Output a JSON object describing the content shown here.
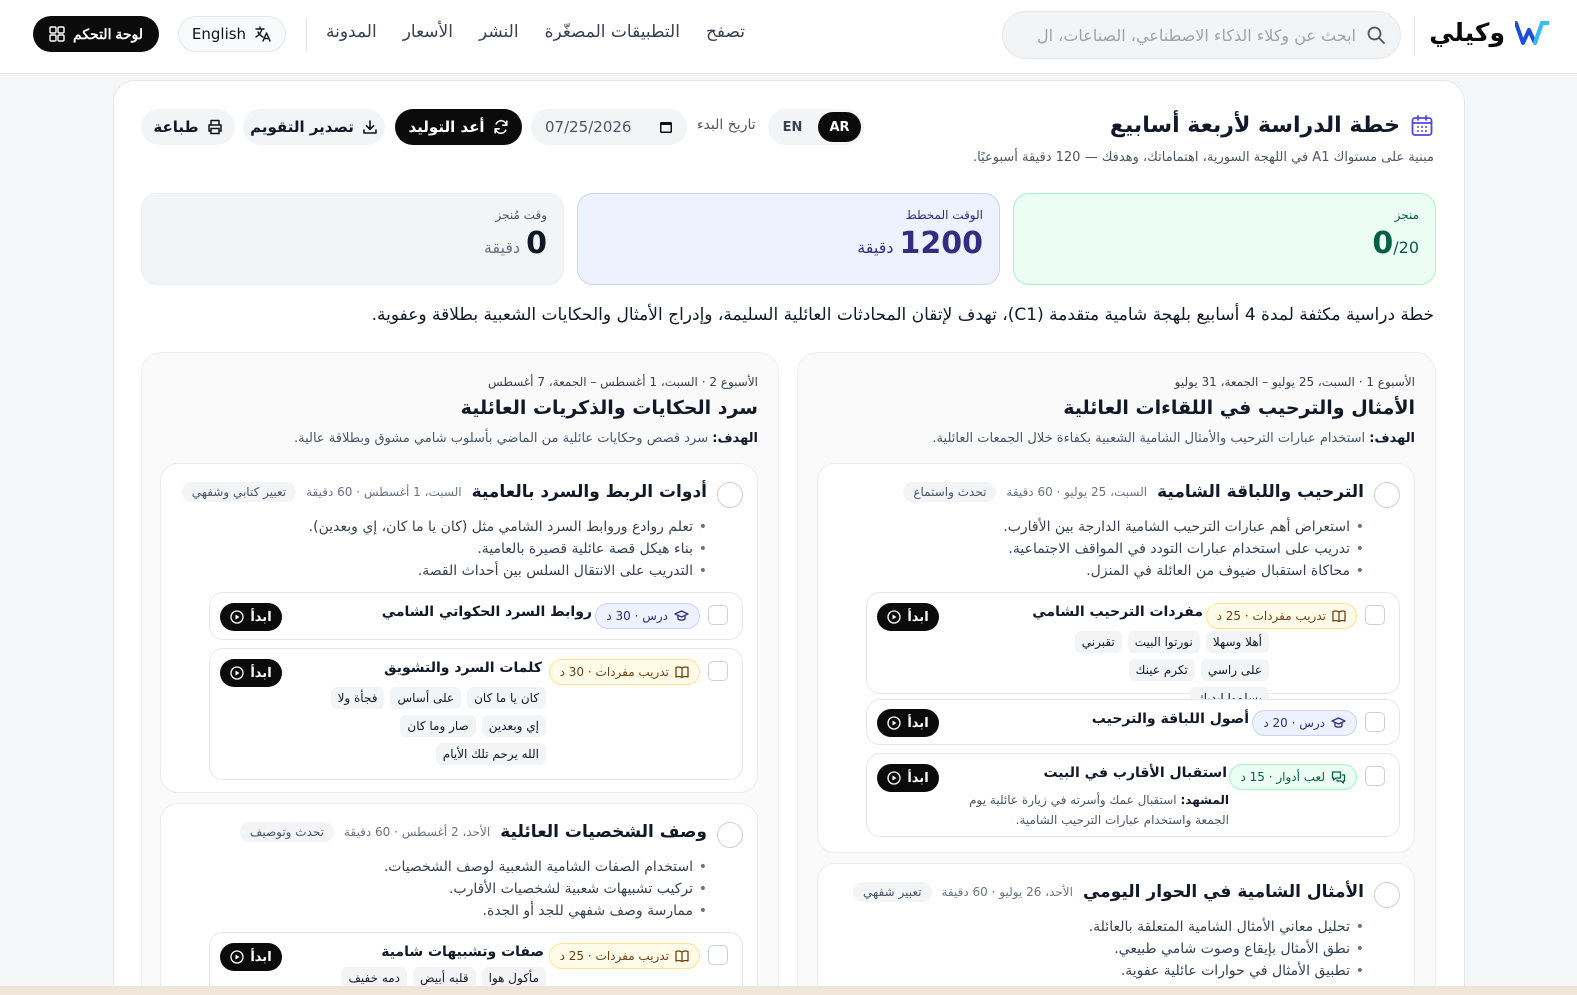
{
  "brand": {
    "name": "وكيلي"
  },
  "search": {
    "placeholder": "ابحث عن وكلاء الذكاء الاصطناعي، الصناعات، ال"
  },
  "nav": {
    "items": [
      "تصفح",
      "التطبيقات المصغّرة",
      "النشر",
      "الأسعار",
      "المدونة"
    ]
  },
  "lang_button": "English",
  "dashboard_button": "لوحة التحكم",
  "plan": {
    "title": "خطة الدراسة لأربعة أسابيع",
    "subtitle": "مبنية على مستواك A1 في اللهجة السورية، اهتماماتك، وهدفك — 120 دقيقة أسبوعيًا.",
    "lang_en": "EN",
    "lang_ar": "AR",
    "start_label": "تاريخ البدء",
    "start_date": "07/25/2026",
    "regenerate": "أعد التوليد",
    "export": "تصدير التقويم",
    "print": "طباعة",
    "description": "خطة دراسية مكثفة لمدة 4 أسابيع بلهجة شامية متقدمة (C1)، تهدف لإتقان المحادثات العائلية السليمة، وإدراج الأمثال والحكايات الشعبية بطلاقة وعفوية."
  },
  "stats": {
    "completed": {
      "label": "منجز",
      "value": "0",
      "total": "/20"
    },
    "planned": {
      "label": "الوقت المخطط",
      "value": "1200",
      "unit": "دقيقة"
    },
    "spent": {
      "label": "وقت مُنجز",
      "value": "0",
      "unit": "دقيقة"
    }
  },
  "goal_label": "الهدف:",
  "start_label": "ابدأ",
  "weeks": [
    {
      "meta": "الأسبوع 1 · السبت، 25 يوليو – الجمعة، 31 يوليو",
      "title": "الأمثال والترحيب في اللقاءات العائلية",
      "goal": "استخدام عبارات الترحيب والأمثال الشامية الشعبية بكفاءة خلال الجمعات العائلية.",
      "days": [
        {
          "title": "الترحيب واللباقة الشامية",
          "meta": "السبت، 25 يوليو · 60 دقيقة",
          "skill": "تحدث واستماع",
          "bullets": [
            "استعراض أهم عبارات الترحيب الشامية الدارجة بين الأقارب.",
            "تدريب على استخدام عبارات التودد في المواقف الاجتماعية.",
            "محاكاة استقبال ضيوف من العائلة في المنزل."
          ],
          "activities": [
            {
              "tag": "تدريب مفردات · 25 د",
              "title": "مفردات الترحيب الشامي",
              "words": [
                "أهلا وسهلا",
                "نورتوا البيت",
                "تقبرني",
                "على راسي",
                "تكرم عينك",
                "يسلموا إيديك"
              ]
            },
            {
              "tag": "درس · 20 د",
              "title": "أصول اللباقة والترحيب"
            },
            {
              "tag": "لعب أدوار · 15 د",
              "title": "استقبال الأقارب في البيت",
              "scene_label": "المشهد:",
              "scene": "استقبال عمك وأسرته في زيارة عائلية يوم الجمعة واستخدام عبارات الترحيب الشامية."
            }
          ]
        },
        {
          "title": "الأمثال الشامية في الحوار اليومي",
          "meta": "الأحد، 26 يوليو · 60 دقيقة",
          "skill": "تعبير شفهي",
          "bullets": [
            "تحليل معاني الأمثال الشامية المتعلقة بالعائلة.",
            "نطق الأمثال بإيقاع وصوت شامي طبيعي.",
            "تطبيق الأمثال في حوارات عائلية عفوية."
          ]
        }
      ]
    },
    {
      "meta": "الأسبوع 2 · السبت، 1 أغسطس – الجمعة، 7 أغسطس",
      "title": "سرد الحكايات والذكريات العائلية",
      "goal": "سرد قصص وحكايات عائلية من الماضي بأسلوب شامي مشوق وبطلاقة عالية.",
      "days": [
        {
          "title": "أدوات الربط والسرد بالعامية",
          "meta": "السبت، 1 أغسطس · 60 دقيقة",
          "skill": "تعبير كتابي وشفهي",
          "bullets": [
            "تعلم روادع وروابط السرد الشامي مثل (كان يا ما كان، إي وبعدين).",
            "بناء هيكل قصة عائلية قصيرة بالعامية.",
            "التدريب على الانتقال السلس بين أحداث القصة."
          ],
          "activities": [
            {
              "tag": "درس · 30 د",
              "title": "روابط السرد الحكواتي الشامي"
            },
            {
              "tag": "تدريب مفردات · 30 د",
              "title": "كلمات السرد والتشويق",
              "words": [
                "كان يا ما كان",
                "على أساس",
                "فجأة ولا",
                "إي وبعدين",
                "صار وما كان",
                "الله يرحم تلك الأيام"
              ]
            }
          ]
        },
        {
          "title": "وصف الشخصيات العائلية",
          "meta": "الأحد، 2 أغسطس · 60 دقيقة",
          "skill": "تحدث وتوصيف",
          "bullets": [
            "استخدام الصفات الشامية الشعبية لوصف الشخصيات.",
            "تركيب تشبيهات شعبية لشخصيات الأقارب.",
            "ممارسة وصف شفهي للجد أو الجدة."
          ],
          "activities": [
            {
              "tag": "تدريب مفردات · 25 د",
              "title": "صفات وتشبيهات شامية",
              "words": [
                "مأكول هوا",
                "قلبه أبيض",
                "دمه خفيف"
              ]
            }
          ]
        }
      ]
    }
  ]
}
